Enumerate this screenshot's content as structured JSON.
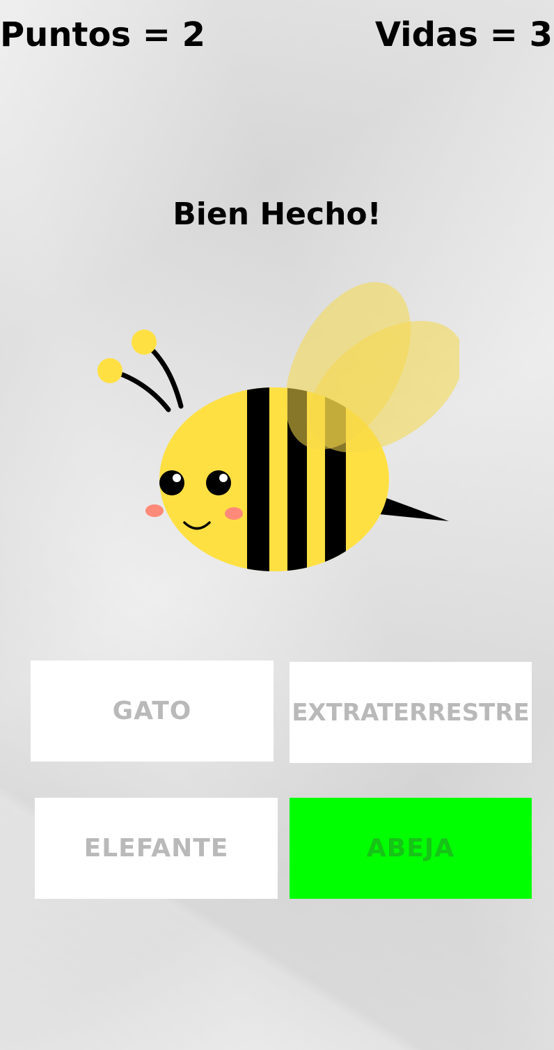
{
  "hud": {
    "score_text": "Puntos = 2",
    "lives_text": "Vidas = 3"
  },
  "feedback": {
    "message": "Bien Hecho!"
  },
  "picture": {
    "subject_icon": "bee-icon",
    "colors": {
      "body": "#ffe043",
      "stripes": "#000000",
      "wings": "#f5d94a",
      "cheeks": "#ff8a7a"
    }
  },
  "answers": {
    "options": [
      {
        "label": "GATO",
        "state": "neutral"
      },
      {
        "label": "EXTRATERRESTRE",
        "state": "neutral"
      },
      {
        "label": "ELEFANTE",
        "state": "neutral"
      },
      {
        "label": "ABEJA",
        "state": "correct"
      }
    ],
    "colors": {
      "neutral_bg": "#ffffff",
      "neutral_text": "#b9b9b9",
      "correct_bg": "#00ff00",
      "correct_text": "#16c316"
    }
  }
}
